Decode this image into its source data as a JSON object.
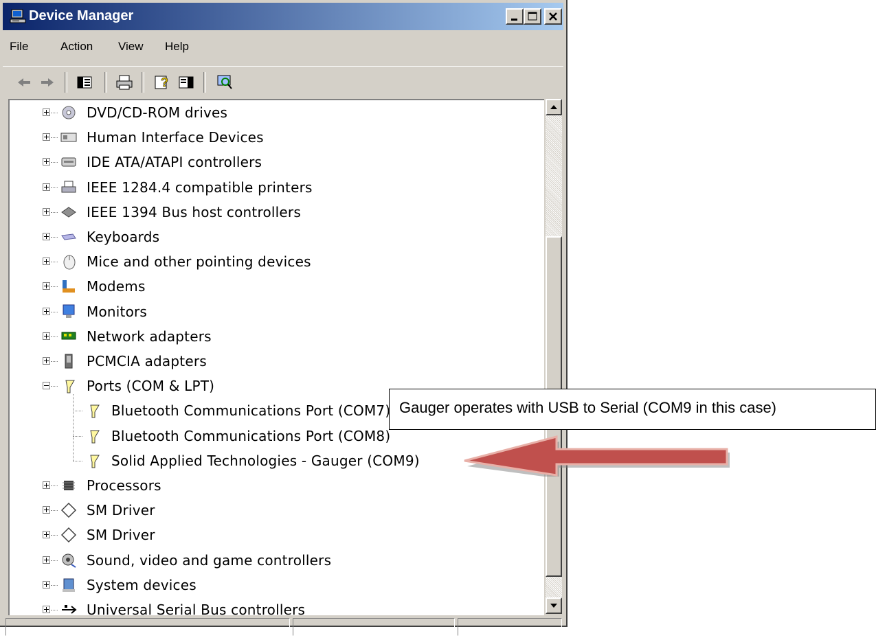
{
  "window": {
    "title": "Device Manager",
    "icon": "computer-icon"
  },
  "menu": [
    {
      "label": "File"
    },
    {
      "label": "Action"
    },
    {
      "label": "View"
    },
    {
      "label": "Help"
    }
  ],
  "toolbar": [
    "back-arrow-icon",
    "forward-arrow-icon",
    "show-hide-console-tree-icon",
    "print-icon",
    "help-icon",
    "properties-icon",
    "scan-hardware-icon"
  ],
  "tree": {
    "items": [
      {
        "label": "DVD/CD-ROM drives",
        "icon": "dvd-drive-icon",
        "expander": "plus"
      },
      {
        "label": "Human Interface Devices",
        "icon": "hid-icon",
        "expander": "plus"
      },
      {
        "label": "IDE ATA/ATAPI controllers",
        "icon": "ide-controller-icon",
        "expander": "plus"
      },
      {
        "label": "IEEE 1284.4 compatible printers",
        "icon": "printer-icon",
        "expander": "plus"
      },
      {
        "label": "IEEE 1394 Bus host controllers",
        "icon": "firewire-icon",
        "expander": "plus"
      },
      {
        "label": "Keyboards",
        "icon": "keyboard-icon",
        "expander": "plus"
      },
      {
        "label": "Mice and other pointing devices",
        "icon": "mouse-icon",
        "expander": "plus"
      },
      {
        "label": "Modems",
        "icon": "modem-icon",
        "expander": "plus"
      },
      {
        "label": "Monitors",
        "icon": "monitor-icon",
        "expander": "plus"
      },
      {
        "label": "Network adapters",
        "icon": "network-adapter-icon",
        "expander": "plus"
      },
      {
        "label": "PCMCIA adapters",
        "icon": "pcmcia-icon",
        "expander": "plus"
      },
      {
        "label": "Ports (COM & LPT)",
        "icon": "port-icon",
        "expander": "minus"
      },
      {
        "label": "Bluetooth Communications Port (COM7)",
        "icon": "port-icon",
        "child": true
      },
      {
        "label": "Bluetooth Communications Port (COM8)",
        "icon": "port-icon",
        "child": true
      },
      {
        "label": "Solid Applied Technologies - Gauger (COM9)",
        "icon": "port-icon",
        "child": true
      },
      {
        "label": "Processors",
        "icon": "processor-icon",
        "expander": "plus"
      },
      {
        "label": "SM Driver",
        "icon": "sm-driver-icon",
        "expander": "plus"
      },
      {
        "label": "SM Driver",
        "icon": "sm-driver-icon",
        "expander": "plus"
      },
      {
        "label": "Sound, video and game controllers",
        "icon": "sound-icon",
        "expander": "plus"
      },
      {
        "label": "System devices",
        "icon": "system-devices-icon",
        "expander": "plus"
      },
      {
        "label": "Universal Serial Bus controllers",
        "icon": "usb-icon",
        "expander": "plus"
      }
    ]
  },
  "callout": {
    "text": "Gauger operates with USB to Serial (COM9 in this case)"
  },
  "colors": {
    "title_gradient_start": "#0a246a",
    "title_gradient_end": "#a6caf0",
    "chrome": "#d4d0c8",
    "arrow_fill": "#c0504d"
  }
}
